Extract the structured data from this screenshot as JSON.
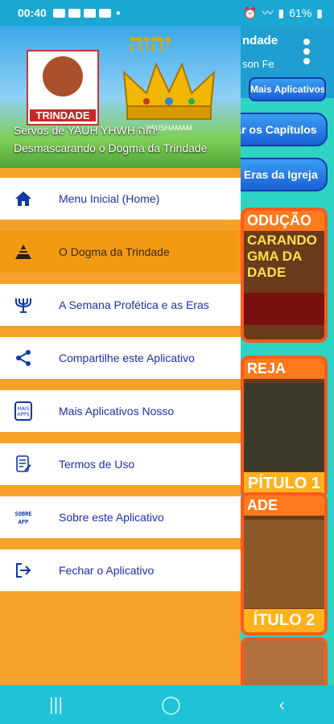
{
  "status": {
    "time": "00:40",
    "battery": "61%"
  },
  "background": {
    "title": "ndade",
    "subtitle": "son Fe",
    "mais_button": "Mais Aplicativos",
    "pill1": "ar os Capítulos",
    "pill2": "s Eras da Igreja",
    "card1_top": "ODUÇÃO",
    "card1_text": "CARANDO\nGMA DA\nDADE",
    "card2_top": "REJA",
    "card2_foot": "PÍTULO 1",
    "card3_top": "ADE",
    "card3_foot": "ÍTULO 2"
  },
  "header": {
    "logo_label": "TRINDADE",
    "hebrew": "יהוה",
    "yausa": "YAUSHAMAM",
    "title": "Servos de YAUH YHWH יהוה",
    "subtitle": "Desmascarando o Dogma da Trindade"
  },
  "menu": [
    {
      "label": "Menu Inicial (Home)",
      "icon": "home-icon"
    },
    {
      "label": "O Dogma da Trindade",
      "icon": "pyramid-icon"
    },
    {
      "label": "A Semana Profética e as Eras",
      "icon": "menorah-icon"
    },
    {
      "label": "Compartilhe este Aplicativo",
      "icon": "share-icon"
    },
    {
      "label": "Mais Aplicativos Nosso",
      "icon": "mais-apps-icon"
    },
    {
      "label": "Termos de Uso",
      "icon": "terms-icon"
    },
    {
      "label": "Sobre este Aplicativo",
      "icon": "sobre-app-icon"
    },
    {
      "label": "Fechar o Aplicativo",
      "icon": "exit-icon"
    }
  ]
}
